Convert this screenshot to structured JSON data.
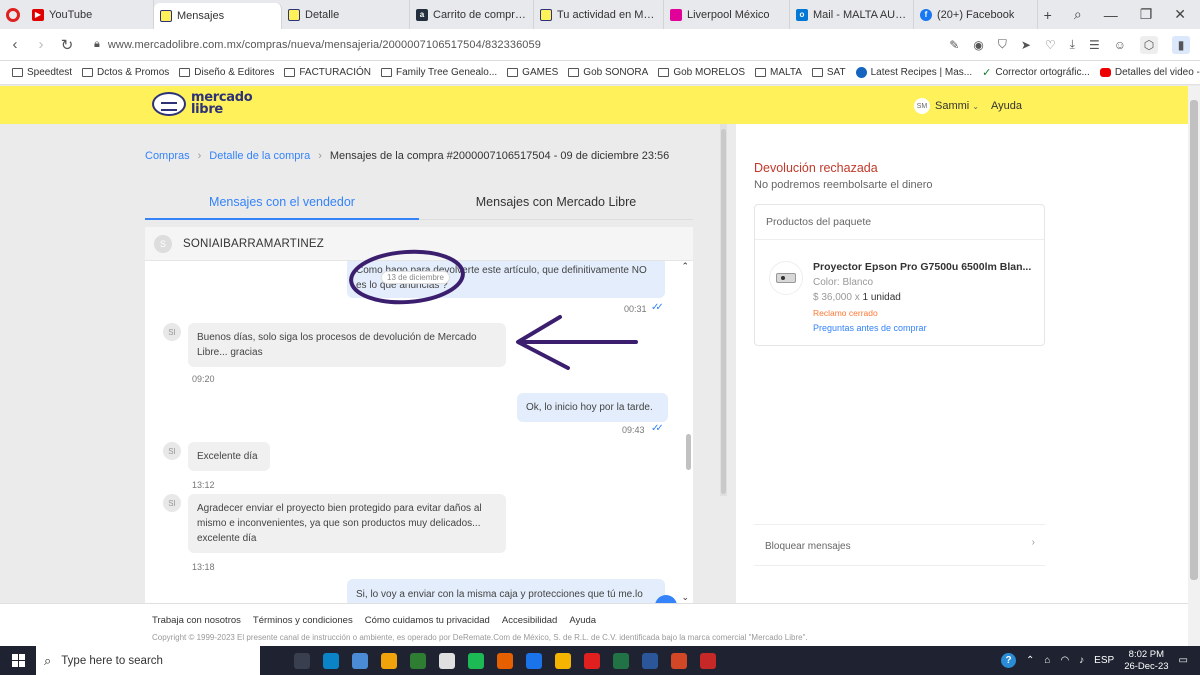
{
  "browser": {
    "tabs": [
      {
        "title": "YouTube",
        "color": "#e00000",
        "active": false
      },
      {
        "title": "Mensajes",
        "color": "#fff159",
        "active": true
      },
      {
        "title": "Detalle",
        "color": "#fff159",
        "active": false
      },
      {
        "title": "Carrito de compras de Am",
        "color": "#232f3e",
        "active": false
      },
      {
        "title": "Tu actividad en Mercado L",
        "color": "#fff159",
        "active": false
      },
      {
        "title": "Liverpool México",
        "color": "#e10098",
        "active": false
      },
      {
        "title": "Mail - MALTA AUDIOVISU",
        "color": "#0078d4",
        "active": false
      },
      {
        "title": "(20+) Facebook",
        "color": "#1877f2",
        "active": false
      }
    ],
    "url": "www.mercadolibre.com.mx/compras/nueva/mensajeria/2000007106517504/832336059",
    "bookmarks": [
      {
        "label": "Speedtest",
        "icon": "folder"
      },
      {
        "label": "Dctos & Promos",
        "icon": "folder"
      },
      {
        "label": "Diseño & Editores",
        "icon": "folder"
      },
      {
        "label": "FACTURACIÓN",
        "icon": "folder"
      },
      {
        "label": "Family Tree Genealo...",
        "icon": "folder"
      },
      {
        "label": "GAMES",
        "icon": "folder"
      },
      {
        "label": "Gob SONORA",
        "icon": "folder"
      },
      {
        "label": "Gob MORELOS",
        "icon": "folder"
      },
      {
        "label": "MALTA",
        "icon": "folder"
      },
      {
        "label": "SAT",
        "icon": "folder"
      },
      {
        "label": "Latest Recipes | Mas...",
        "icon": "round"
      },
      {
        "label": "Corrector ortográfic...",
        "icon": "green"
      },
      {
        "label": "Detalles del video -...",
        "icon": "yt"
      }
    ],
    "more": "»"
  },
  "header": {
    "logo_line1": "mercado",
    "logo_line2": "libre",
    "user_initials": "SM",
    "user_name": "Sammi",
    "help": "Ayuda"
  },
  "breadcrumb": {
    "item1": "Compras",
    "item2": "Detalle de la compra",
    "current": "Mensajes de la compra #2000007106517504 - 09 de diciembre 23:56"
  },
  "tabs": {
    "seller": "Mensajes con el vendedor",
    "ml": "Mensajes con Mercado Libre"
  },
  "chat": {
    "contact_initial": "S",
    "contact_name": "SONIAIBARRAMARTINEZ",
    "date_chip": "13 de diciembre",
    "sender_initials": "SI",
    "messages": [
      {
        "text": "Como hago para devolverte este artículo, que definitivamente NO es lo que anuncias ?",
        "time": "00:31"
      },
      {
        "text": "Buenos días,  solo siga los procesos de devolución de Mercado Libre... gracias",
        "time": "09:20"
      },
      {
        "text": "Ok, lo inicio hoy por la tarde.",
        "time": "09:43"
      },
      {
        "text": "Excelente día",
        "time": "13:12"
      },
      {
        "text": "Agradecer enviar el proyecto bien protegido para evitar daños al mismo e inconvenientes, ya que son productos muy delicados... excelente día",
        "time": "13:18"
      },
      {
        "text": "Si, lo voy a enviar con la misma caja y protecciones que tú me.lo",
        "time": ""
      }
    ]
  },
  "sidebar": {
    "return_title": "Devolución rechazada",
    "return_sub": "No podremos reembolsarte el dinero",
    "package_header": "Productos del paquete",
    "product_name": "Proyector Epson Pro G7500u 6500lm Blan...",
    "product_color": "Color: Blanco",
    "price": "$ 36,000 x ",
    "qty": "1 unidad",
    "claim_status": "Reclamo cerrado",
    "questions_link": "Preguntas antes de comprar",
    "block": "Bloquear mensajes"
  },
  "footer": {
    "links": [
      "Trabaja con nosotros",
      "Términos y condiciones",
      "Cómo cuidamos tu privacidad",
      "Accesibilidad",
      "Ayuda"
    ],
    "copyright": "Copyright © 1999-2023 El presente canal de instrucción o ambiente, es operado por DeRemate.Com de México, S. de R.L. de C.V. identificada bajo la marca comercial \"Mercado Libre\"."
  },
  "taskbar": {
    "search_placeholder": "Type here to search",
    "lang": "ESP",
    "time": "8:02 PM",
    "date": "26-Dec-23",
    "app_colors": [
      "#3a3f4f",
      "#0a84c6",
      "#4b8bd6",
      "#f0a30a",
      "#2e7d32",
      "#e0e0e0",
      "#1db954",
      "#e66000",
      "#1a73e8",
      "#f4b400",
      "#e0201e",
      "#217346",
      "#2b579a",
      "#d24726",
      "#c62828"
    ]
  },
  "annotation": {
    "color": "#3b1f6e"
  }
}
